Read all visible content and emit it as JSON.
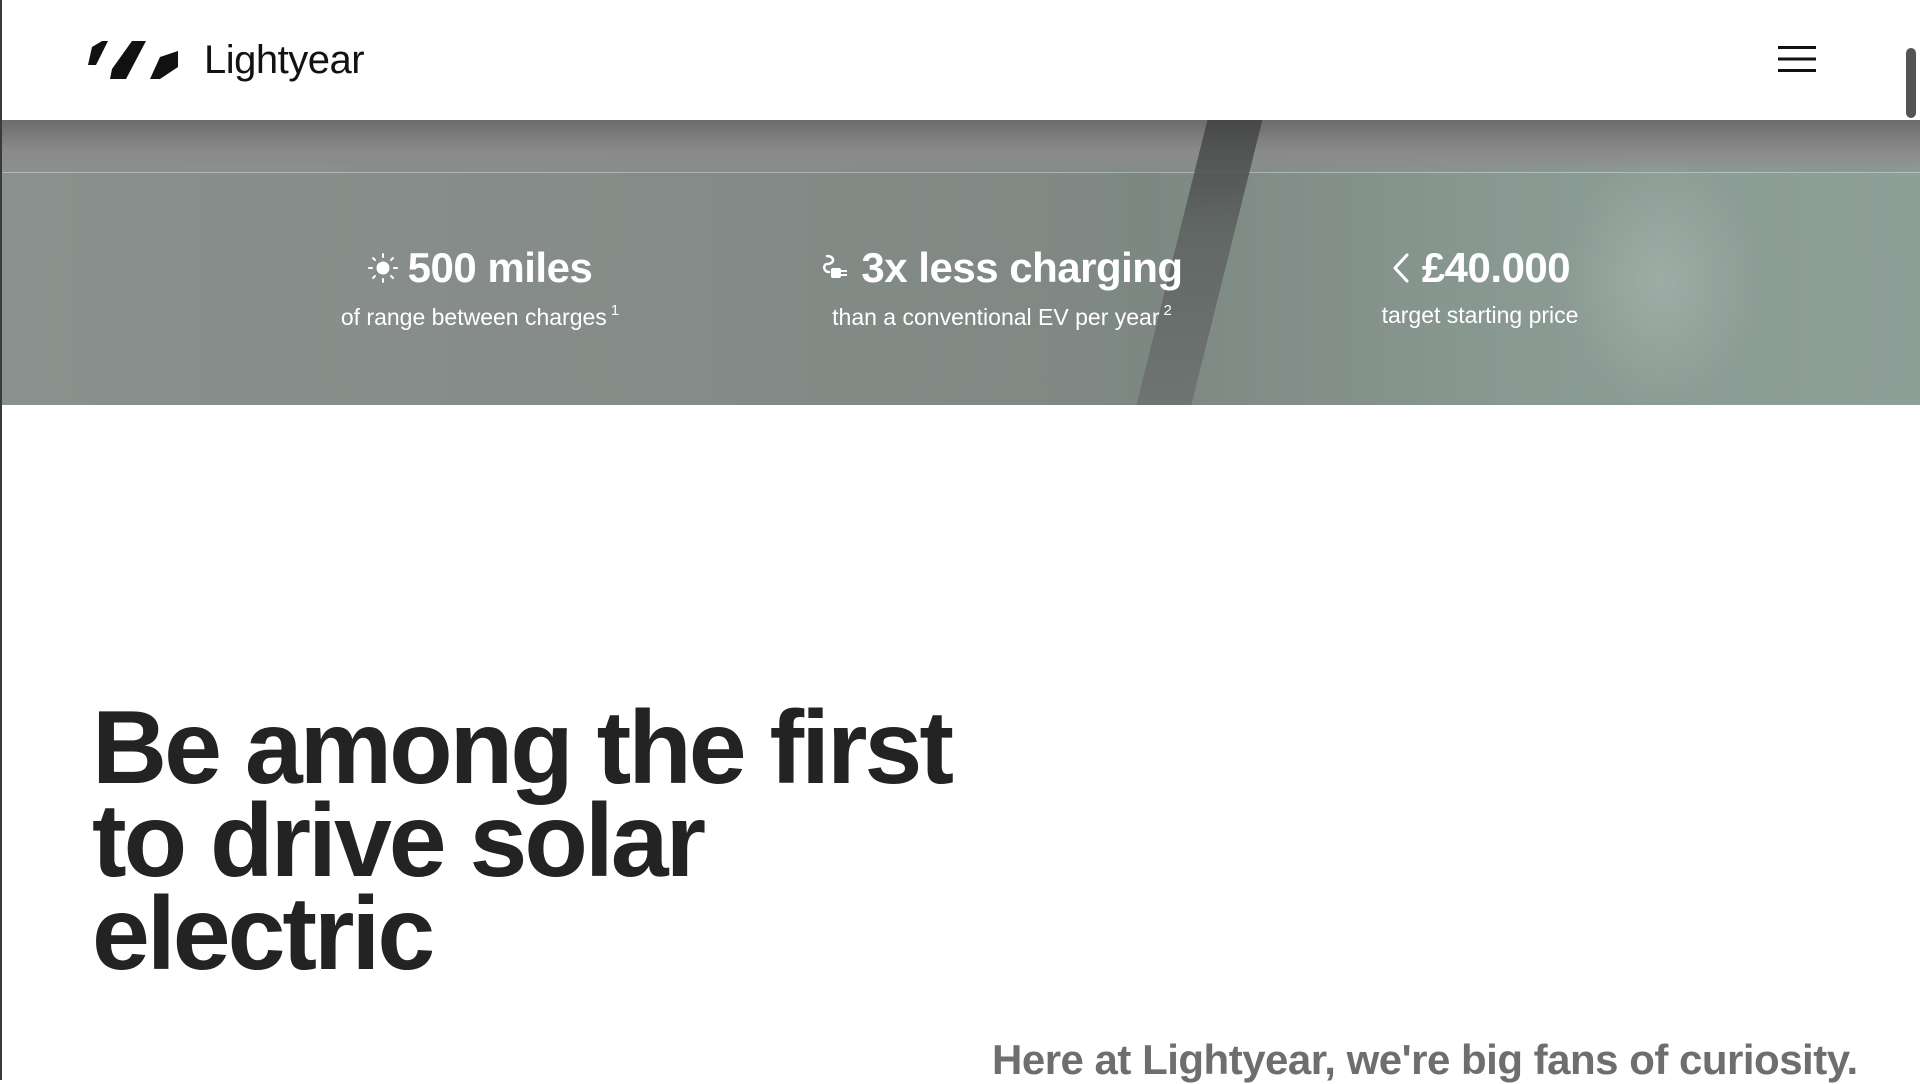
{
  "header": {
    "brand": "Lightyear",
    "logo_icon": "lightyear-logo-icon",
    "menu_icon": "hamburger-menu-icon"
  },
  "stats": [
    {
      "icon": "sun-icon",
      "value": "500 miles",
      "label": "of range between charges",
      "footnote": "1"
    },
    {
      "icon": "charging-plug-icon",
      "value": "3x less charging",
      "label": "than a conventional EV per year",
      "footnote": "2"
    },
    {
      "icon": "chevron-left-icon",
      "value": "£40.000",
      "label": "target starting price",
      "footnote": ""
    }
  ],
  "main": {
    "heading": "Be among the first to drive solar electric",
    "intro": "Here at Lightyear, we're big fans of curiosity."
  },
  "colors": {
    "text_dark": "#232323",
    "text_muted": "#6e6e6e",
    "hero_band": "#858b88"
  }
}
